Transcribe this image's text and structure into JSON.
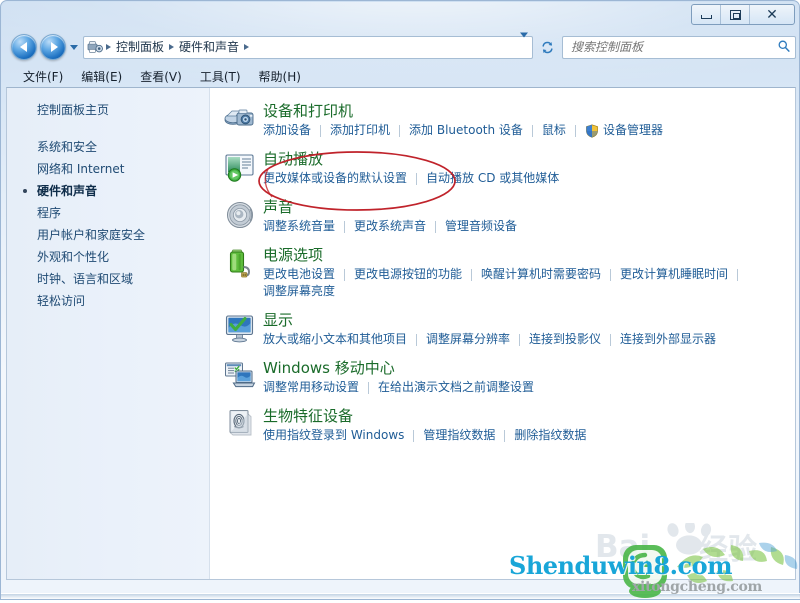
{
  "window": {
    "buttons": {
      "minimize": "minimize-button",
      "maximize": "maximize-button",
      "close": "close-button",
      "close_glyph": "✕"
    }
  },
  "navigation": {
    "back_label": "后退",
    "forward_label": "前进",
    "history_label": "最近浏览的位置",
    "refresh_label": "刷新",
    "refresh_glyph": "↻",
    "address": {
      "icon": "control-panel-icon",
      "crumbs": [
        "控制面板",
        "硬件和声音"
      ],
      "dropdown": "previous-locations"
    }
  },
  "search": {
    "placeholder": "搜索控制面板",
    "value": "",
    "icon": "search-icon"
  },
  "menubar": {
    "items": [
      {
        "label": "文件(F)"
      },
      {
        "label": "编辑(E)"
      },
      {
        "label": "查看(V)"
      },
      {
        "label": "工具(T)"
      },
      {
        "label": "帮助(H)"
      }
    ]
  },
  "sidebar": {
    "home": "控制面板主页",
    "items": [
      {
        "label": "系统和安全",
        "active": false
      },
      {
        "label": "网络和 Internet",
        "active": false
      },
      {
        "label": "硬件和声音",
        "active": true
      },
      {
        "label": "程序",
        "active": false
      },
      {
        "label": "用户帐户和家庭安全",
        "active": false
      },
      {
        "label": "外观和个性化",
        "active": false
      },
      {
        "label": "时钟、语言和区域",
        "active": false
      },
      {
        "label": "轻松访问",
        "active": false
      }
    ]
  },
  "categories": [
    {
      "id": "devices-and-printers",
      "icon": "printer-camera-icon",
      "title": "设备和打印机",
      "links": [
        {
          "label": "添加设备",
          "shield": false
        },
        {
          "label": "添加打印机",
          "shield": false
        },
        {
          "label": "添加 Bluetooth 设备",
          "shield": false
        },
        {
          "label": "鼠标",
          "shield": false
        },
        {
          "label": "设备管理器",
          "shield": true
        }
      ]
    },
    {
      "id": "autoplay",
      "icon": "autoplay-icon",
      "title": "自动播放",
      "links": [
        {
          "label": "更改媒体或设备的默认设置",
          "shield": false
        },
        {
          "label": "自动播放 CD 或其他媒体",
          "shield": false
        }
      ]
    },
    {
      "id": "sound",
      "icon": "speaker-icon",
      "title": "声音",
      "links": [
        {
          "label": "调整系统音量",
          "shield": false
        },
        {
          "label": "更改系统声音",
          "shield": false
        },
        {
          "label": "管理音频设备",
          "shield": false
        }
      ]
    },
    {
      "id": "power-options",
      "icon": "battery-icon",
      "title": "电源选项",
      "links": [
        {
          "label": "更改电池设置",
          "shield": false
        },
        {
          "label": "更改电源按钮的功能",
          "shield": false
        },
        {
          "label": "唤醒计算机时需要密码",
          "shield": false
        },
        {
          "label": "更改计算机睡眠时间",
          "shield": false
        },
        {
          "label": "调整屏幕亮度",
          "shield": false
        }
      ]
    },
    {
      "id": "display",
      "icon": "monitor-icon",
      "title": "显示",
      "links": [
        {
          "label": "放大或缩小文本和其他项目",
          "shield": false
        },
        {
          "label": "调整屏幕分辨率",
          "shield": false
        },
        {
          "label": "连接到投影仪",
          "shield": false
        },
        {
          "label": "连接到外部显示器",
          "shield": false
        }
      ]
    },
    {
      "id": "windows-mobility-center",
      "icon": "laptop-mobility-icon",
      "title": "Windows 移动中心",
      "links": [
        {
          "label": "调整常用移动设置",
          "shield": false
        },
        {
          "label": "在给出演示文档之前调整设置",
          "shield": false
        }
      ]
    },
    {
      "id": "biometric-devices",
      "icon": "fingerprint-icon",
      "title": "生物特征设备",
      "links": [
        {
          "label": "使用指纹登录到 Windows",
          "shield": false
        },
        {
          "label": "管理指纹数据",
          "shield": false
        },
        {
          "label": "删除指纹数据",
          "shield": false
        }
      ]
    }
  ],
  "annotation": {
    "shape": "red-ellipse",
    "target": "自动播放",
    "color": "#c0232b"
  },
  "watermarks": {
    "baidu": "Bai 经验",
    "baidu_latin": "Bai",
    "baidu_cjk": "经验",
    "shendu": "Shenduwin8.com",
    "xitong": "xitongcheng.com"
  },
  "colors": {
    "category_title": "#1a6b2a",
    "link": "#1f5c96",
    "sidebar_link": "#1f4a73",
    "annotation": "#c0232b",
    "shendu_blue": "#19a6d8",
    "logo_green": "#4ab648"
  }
}
